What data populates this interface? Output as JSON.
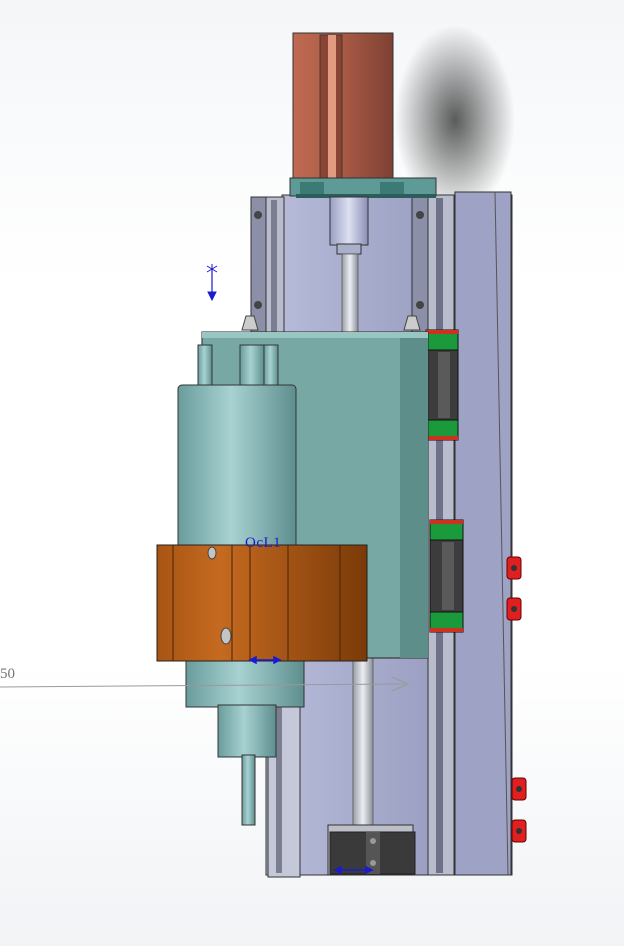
{
  "viewport": {
    "annotations": {
      "dimension_value": "50",
      "sketch_label": "OcL1"
    },
    "colors": {
      "motor_body": "#b0604a",
      "motor_flange": "#5c9a95",
      "frame_plate": "#9aa0c4",
      "rail": "#8a8fa8",
      "carriage": "#78a8a4",
      "spindle": "#8fc0c0",
      "clamp": "#b8621d",
      "rail_block_seal": "#1a9a3a",
      "sensor": "#e02020",
      "annotation_blue": "#1a1ad0"
    }
  }
}
